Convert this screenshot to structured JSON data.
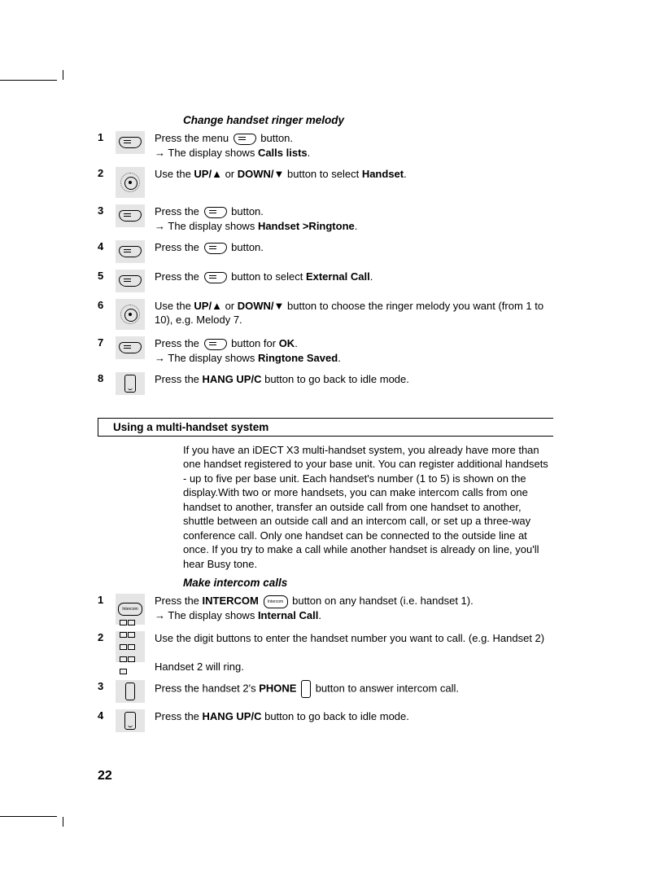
{
  "section1": {
    "title": "Change handset ringer melody",
    "steps": [
      {
        "num": "1",
        "txt_pre": "Press the menu ",
        "txt_post": " button.",
        "sub": "→ The display shows ",
        "sub_bold": "Calls lists",
        "sub_end": ".",
        "icon": "menu",
        "inline_icon": "menu"
      },
      {
        "num": "2",
        "txt": "Use the <b>UP/▲</b> or <b>DOWN/▼</b> button to select <b>Handset</b>.",
        "icon": "nav"
      },
      {
        "num": "3",
        "txt_pre": "Press the ",
        "txt_post": " button.",
        "sub": "→ The display shows ",
        "sub_bold": "Handset >Ringtone",
        "sub_end": ".",
        "icon": "menu",
        "inline_icon": "menu"
      },
      {
        "num": "4",
        "txt_pre": "Press the ",
        "txt_post": " button.",
        "icon": "menu",
        "inline_icon": "menu"
      },
      {
        "num": "5",
        "txt_pre": "Press the ",
        "txt_post": " button to select <b>External Call</b>.",
        "icon": "menu",
        "inline_icon": "menu"
      },
      {
        "num": "6",
        "txt": "Use the <b>UP/▲</b> or <b>DOWN/▼</b> button to choose the ringer melody you want (from 1 to 10), e.g. Melody 7.",
        "icon": "nav"
      },
      {
        "num": "7",
        "txt_pre": "Press the ",
        "txt_post": " button for <b>OK</b>.",
        "sub": "→ The display shows ",
        "sub_bold": "Ringtone Saved",
        "sub_end": ".",
        "icon": "menu",
        "inline_icon": "menu"
      },
      {
        "num": "8",
        "txt": "Press the <b>HANG UP/C</b> button to go back to idle mode.",
        "icon": "hang"
      }
    ]
  },
  "subsection": {
    "title": "Using a multi-handset system",
    "paragraph": "If you have an iDECT X3 multi-handset system, you already have more than one handset registered to your base unit. You can register additional handsets - up to five per base unit. Each handset's number (1 to 5) is shown on the display.With two or more handsets, you can make intercom calls from one handset to another, transfer an outside call from one handset to another, shuttle between an outside call and an intercom call, or set up a three-way conference call. Only one handset can be connected to the outside line at once. If you try to make a call while another handset is already on line, you'll hear Busy tone."
  },
  "section2": {
    "title": "Make intercom calls",
    "steps": [
      {
        "num": "1",
        "txt_pre": "Press the <b>INTERCOM</b> ",
        "txt_post": " button on any handset (i.e. handset 1).",
        "sub": "→ The display shows ",
        "sub_bold": "Internal Call",
        "sub_end": ".",
        "icon": "intercom",
        "inline_icon": "intercom"
      },
      {
        "num": "2",
        "txt": "Use the digit buttons to enter the handset number you want to call. (e.g. Handset 2)",
        "extra": "Handset 2 will ring.",
        "icon": "keypad"
      },
      {
        "num": "3",
        "txt_pre": "Press the handset 2's  <b>PHONE</b> ",
        "txt_post": " button to answer intercom call.",
        "icon": "phone",
        "inline_icon": "phone"
      },
      {
        "num": "4",
        "txt": "Press the <b>HANG UP/C</b> button to go back to idle mode.",
        "icon": "hang"
      }
    ]
  },
  "page_number": "22"
}
